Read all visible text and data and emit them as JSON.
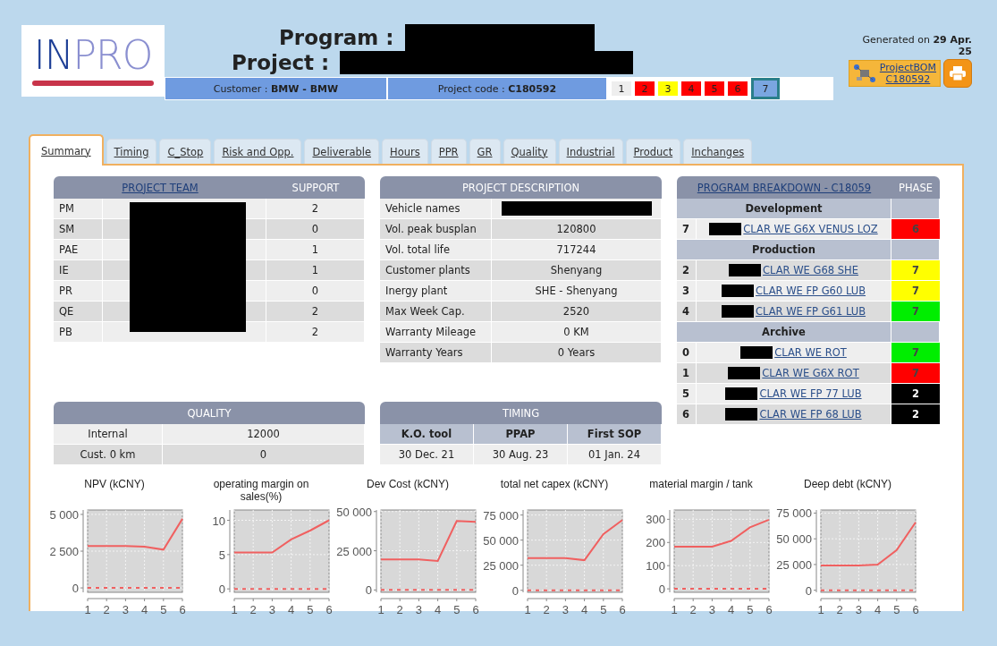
{
  "logo": {
    "part_1": "IN",
    "part_2": "PRO"
  },
  "title": {
    "program_label": "Program :",
    "project_label": "Project :"
  },
  "info_bar": {
    "customer": "Customer : **BMW - BMW**",
    "project_code": "Project code : **C180592**"
  },
  "phases": [
    {
      "label": "1",
      "color": "#eeeeee",
      "selected": false
    },
    {
      "label": "2",
      "color": "#ff0000",
      "selected": false
    },
    {
      "label": "3",
      "color": "#ffff00",
      "selected": false
    },
    {
      "label": "4",
      "color": "#ff0000",
      "selected": false
    },
    {
      "label": "5",
      "color": "#ff0000",
      "selected": false
    },
    {
      "label": "6",
      "color": "#ff0000",
      "selected": false
    },
    {
      "label": "7",
      "color": "#7aa6e0",
      "selected": true
    }
  ],
  "generated": "Generated on **29 Apr. 25**",
  "bom_link": {
    "line_1": "ProjectBOM",
    "line_2": "C180592"
  },
  "tabs": [
    {
      "label": "Summary",
      "selected": true
    },
    {
      "label": "Timing",
      "selected": false
    },
    {
      "label": "C_Stop",
      "selected": false
    },
    {
      "label": "Risk and Opp.",
      "selected": false
    },
    {
      "label": "Deliverable",
      "selected": false
    },
    {
      "label": "Hours",
      "selected": false
    },
    {
      "label": "PPR",
      "selected": false
    },
    {
      "label": "GR",
      "selected": false
    },
    {
      "label": "Quality",
      "selected": false
    },
    {
      "label": "Industrial",
      "selected": false
    },
    {
      "label": "Product",
      "selected": false
    },
    {
      "label": "Inchanges",
      "selected": false
    }
  ],
  "project_team": {
    "title": "PROJECT TEAM",
    "support_header": "SUPPORT",
    "rows": [
      {
        "role": "PM",
        "support": "2"
      },
      {
        "role": "SM",
        "support": "0"
      },
      {
        "role": "PAE",
        "support": "1"
      },
      {
        "role": "IE",
        "support": "1"
      },
      {
        "role": "PR",
        "support": "0"
      },
      {
        "role": "QE",
        "support": "2"
      },
      {
        "role": "PB",
        "support": "2"
      }
    ]
  },
  "project_description": {
    "title": "PROJECT DESCRIPTION",
    "rows": [
      {
        "label": "Vehicle names",
        "value": ""
      },
      {
        "label": "Vol. peak busplan",
        "value": "120800"
      },
      {
        "label": "Vol. total life",
        "value": "717244"
      },
      {
        "label": "Customer plants",
        "value": "Shenyang"
      },
      {
        "label": "Inergy plant",
        "value": "SHE - Shenyang"
      },
      {
        "label": "Max Week Cap.",
        "value": "2520"
      },
      {
        "label": "Warranty Mileage",
        "value": "0 KM"
      },
      {
        "label": "Warranty Years",
        "value": "0 Years"
      }
    ]
  },
  "program_breakdown": {
    "title": "PROGRAM BREAKDOWN - C18059",
    "phase_header": "PHASE",
    "sections": [
      {
        "heading": "Development",
        "items": [
          {
            "number": "7",
            "name": "CLAR WE G6X VENUS LOZ",
            "phase": "6",
            "color": "#ff0000"
          }
        ]
      },
      {
        "heading": "Production",
        "items": [
          {
            "number": "2",
            "name": "CLAR WE G68 SHE",
            "phase": "7",
            "color": "#ffff00"
          },
          {
            "number": "3",
            "name": "CLAR WE FP G60 LUB",
            "phase": "7",
            "color": "#ffff00"
          },
          {
            "number": "4",
            "name": "CLAR WE FP G61 LUB",
            "phase": "7",
            "color": "#00ee00"
          }
        ]
      },
      {
        "heading": "Archive",
        "items": [
          {
            "number": "0",
            "name": "CLAR WE ROT",
            "phase": "7",
            "color": "#00ee00"
          },
          {
            "number": "1",
            "name": "CLAR WE G6X ROT",
            "phase": "7",
            "color": "#ff0000"
          },
          {
            "number": "5",
            "name": "CLAR WE FP 77 LUB",
            "phase": "2",
            "color": "#000000"
          },
          {
            "number": "6",
            "name": "CLAR WE FP 68 LUB",
            "phase": "2",
            "color": "#000000"
          }
        ]
      }
    ]
  },
  "quality": {
    "title": "QUALITY",
    "rows": [
      {
        "label": "Internal",
        "value": "12000"
      },
      {
        "label": "Cust. 0 km",
        "value": "0"
      }
    ]
  },
  "timing": {
    "title": "TIMING",
    "columns": [
      "K.O. tool",
      "PPAP",
      "First SOP"
    ],
    "values": [
      "30 Dec. 21",
      "30 Aug. 23",
      "01 Jan. 24"
    ]
  },
  "charts": [
    {
      "chart_data": {
        "type": "line",
        "title": "NPV (kCNY)",
        "x": [
          1,
          2,
          3,
          4,
          5,
          6
        ],
        "xlim": [
          1,
          6
        ],
        "ylim": [
          -300,
          5300
        ],
        "grid": true,
        "xticks": [
          1,
          2,
          3,
          4,
          5,
          6
        ],
        "yticks": [
          {
            "value": 0,
            "label": "0"
          },
          {
            "value": 2500,
            "label": "2 500"
          },
          {
            "value": 5000,
            "label": "5 000"
          }
        ],
        "series": [
          {
            "color": "#f06060",
            "line_style": "solid",
            "values": [
              2850,
              2850,
              2850,
              2800,
              2600,
              4700
            ]
          },
          {
            "color": "#f06060",
            "line_style": "dashed",
            "values": [
              0,
              0,
              0,
              0,
              0,
              0
            ]
          }
        ]
      }
    },
    {
      "chart_data": {
        "type": "line",
        "title": "operating margin on sales(%)",
        "x": [
          1,
          2,
          3,
          4,
          5,
          6
        ],
        "xlim": [
          1,
          6
        ],
        "ylim": [
          -0.5,
          11.5
        ],
        "grid": true,
        "xticks": [
          1,
          2,
          3,
          4,
          5,
          6
        ],
        "yticks": [
          0,
          5,
          10
        ],
        "series": [
          {
            "color": "#f06060",
            "line_style": "solid",
            "values": [
              5.3,
              5.3,
              5.3,
              7.2,
              8.5,
              10
            ]
          },
          {
            "color": "#f06060",
            "line_style": "dashed",
            "values": [
              0,
              0,
              0,
              0,
              0,
              0
            ]
          }
        ]
      }
    },
    {
      "chart_data": {
        "type": "line",
        "title": "Dev Cost (kCNY)",
        "x": [
          1,
          2,
          3,
          4,
          5,
          6
        ],
        "xlim": [
          1,
          6
        ],
        "ylim": [
          -1500,
          51000
        ],
        "grid": true,
        "xticks": [
          1,
          2,
          3,
          4,
          5,
          6
        ],
        "yticks": [
          {
            "value": 0,
            "label": "0"
          },
          {
            "value": 25000,
            "label": "25 000"
          },
          {
            "value": 50000,
            "label": "50 000"
          }
        ],
        "series": [
          {
            "color": "#f06060",
            "line_style": "solid",
            "values": [
              19500,
              19500,
              19500,
              18500,
              44000,
              43500
            ]
          },
          {
            "color": "#f06060",
            "line_style": "dashed",
            "values": [
              0,
              0,
              0,
              0,
              0,
              0
            ]
          }
        ]
      }
    },
    {
      "chart_data": {
        "type": "line",
        "title": "total net capex (kCNY)",
        "x": [
          1,
          2,
          3,
          4,
          5,
          6
        ],
        "xlim": [
          1,
          6
        ],
        "ylim": [
          -2000,
          80000
        ],
        "grid": true,
        "xticks": [
          1,
          2,
          3,
          4,
          5,
          6
        ],
        "yticks": [
          {
            "value": 0,
            "label": "0"
          },
          {
            "value": 25000,
            "label": "25 000"
          },
          {
            "value": 50000,
            "label": "50 000"
          },
          {
            "value": 75000,
            "label": "75 000"
          }
        ],
        "series": [
          {
            "color": "#f06060",
            "line_style": "solid",
            "values": [
              32000,
              32000,
              32000,
              30000,
              56000,
              70000
            ]
          },
          {
            "color": "#f06060",
            "line_style": "dashed",
            "values": [
              0,
              0,
              0,
              0,
              0,
              0
            ]
          }
        ]
      }
    },
    {
      "chart_data": {
        "type": "line",
        "title": "material margin / tank",
        "x": [
          1,
          2,
          3,
          4,
          5,
          6
        ],
        "xlim": [
          1,
          6
        ],
        "ylim": [
          -15,
          340
        ],
        "grid": true,
        "xticks": [
          1,
          2,
          3,
          4,
          5,
          6
        ],
        "yticks": [
          0,
          100,
          200,
          300
        ],
        "series": [
          {
            "color": "#f06060",
            "line_style": "solid",
            "values": [
              182,
              182,
              182,
              207,
              265,
              298
            ]
          },
          {
            "color": "#f06060",
            "line_style": "dashed",
            "values": [
              0,
              0,
              0,
              0,
              0,
              0
            ]
          }
        ]
      }
    },
    {
      "chart_data": {
        "type": "line",
        "title": "Deep debt (kCNY)",
        "x": [
          1,
          2,
          3,
          4,
          5,
          6
        ],
        "xlim": [
          1,
          6
        ],
        "ylim": [
          -2000,
          78000
        ],
        "grid": true,
        "xticks": [
          1,
          2,
          3,
          4,
          5,
          6
        ],
        "yticks": [
          {
            "value": 0,
            "label": "0"
          },
          {
            "value": 25000,
            "label": "25 000"
          },
          {
            "value": 50000,
            "label": "50 000"
          },
          {
            "value": 75000,
            "label": "75 000"
          }
        ],
        "series": [
          {
            "color": "#f06060",
            "line_style": "solid",
            "values": [
              24000,
              24000,
              24000,
              25000,
              39000,
              66000
            ]
          },
          {
            "color": "#f06060",
            "line_style": "dashed",
            "values": [
              0,
              0,
              0,
              0,
              0,
              0
            ]
          }
        ]
      }
    }
  ]
}
